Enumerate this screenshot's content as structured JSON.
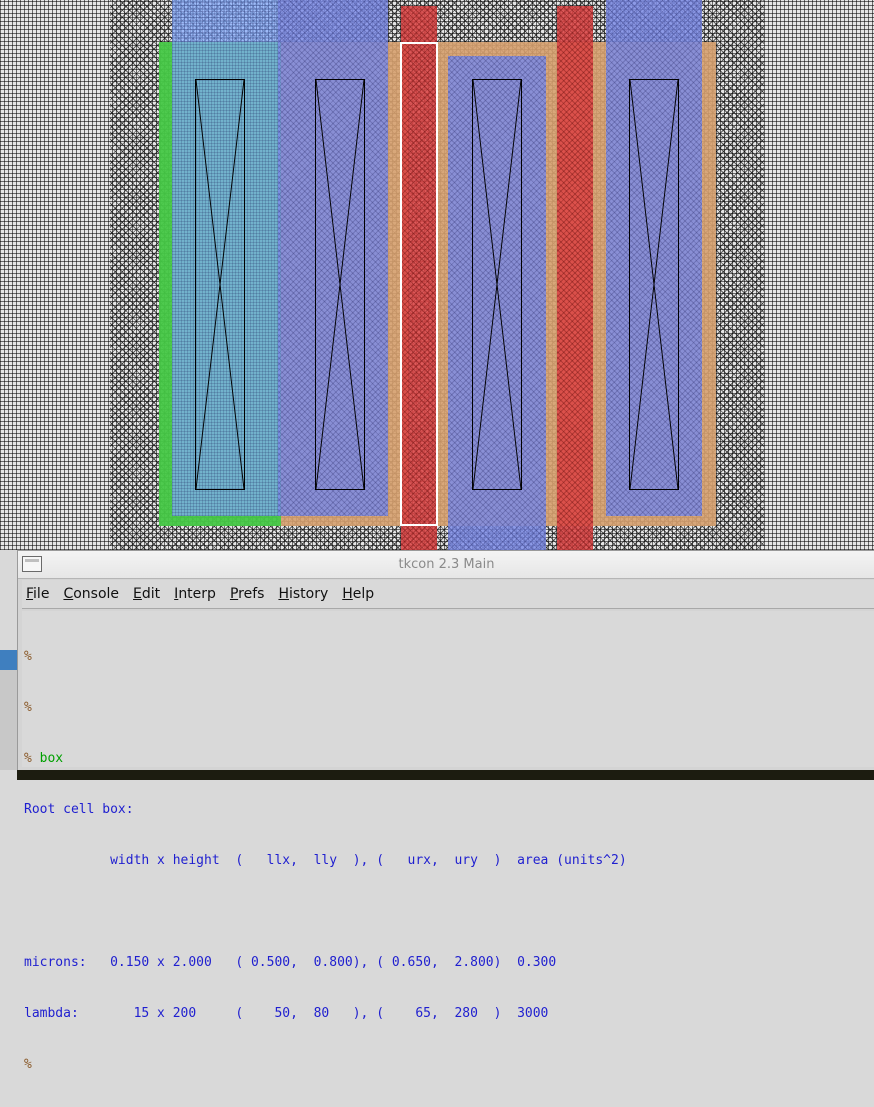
{
  "window": {
    "title": "tkcon 2.3 Main"
  },
  "menu": [
    {
      "label": "File",
      "mnemonic": "F",
      "rest": "ile"
    },
    {
      "label": "Console",
      "mnemonic": "C",
      "rest": "onsole"
    },
    {
      "label": "Edit",
      "mnemonic": "E",
      "rest": "dit"
    },
    {
      "label": "Interp",
      "mnemonic": "I",
      "rest": "nterp"
    },
    {
      "label": "Prefs",
      "mnemonic": "P",
      "rest": "refs"
    },
    {
      "label": "History",
      "mnemonic": "H",
      "rest": "istory"
    },
    {
      "label": "Help",
      "mnemonic": "H",
      "rest": "elp"
    }
  ],
  "console": {
    "prompt": "%",
    "command": "box",
    "lines": {
      "header": "Root cell box:",
      "columns": "           width x height  (   llx,  lly  ), (   urx,  ury  )  area (units^2)",
      "microns": "microns:   0.150 x 2.000   ( 0.500,  0.800), ( 0.650,  2.800)  0.300",
      "lambda": "lambda:       15 x 200     (    50,  80   ), (    65,  280  )  3000"
    }
  },
  "colors": {
    "poly": "#dc4646",
    "metal1": "#82aaff",
    "pdiff": "#d6a06e",
    "ndiff": "#46c846",
    "console_text": "#1f1fd0",
    "console_cmd": "#00a000",
    "prompt": "#8a5a2a"
  }
}
